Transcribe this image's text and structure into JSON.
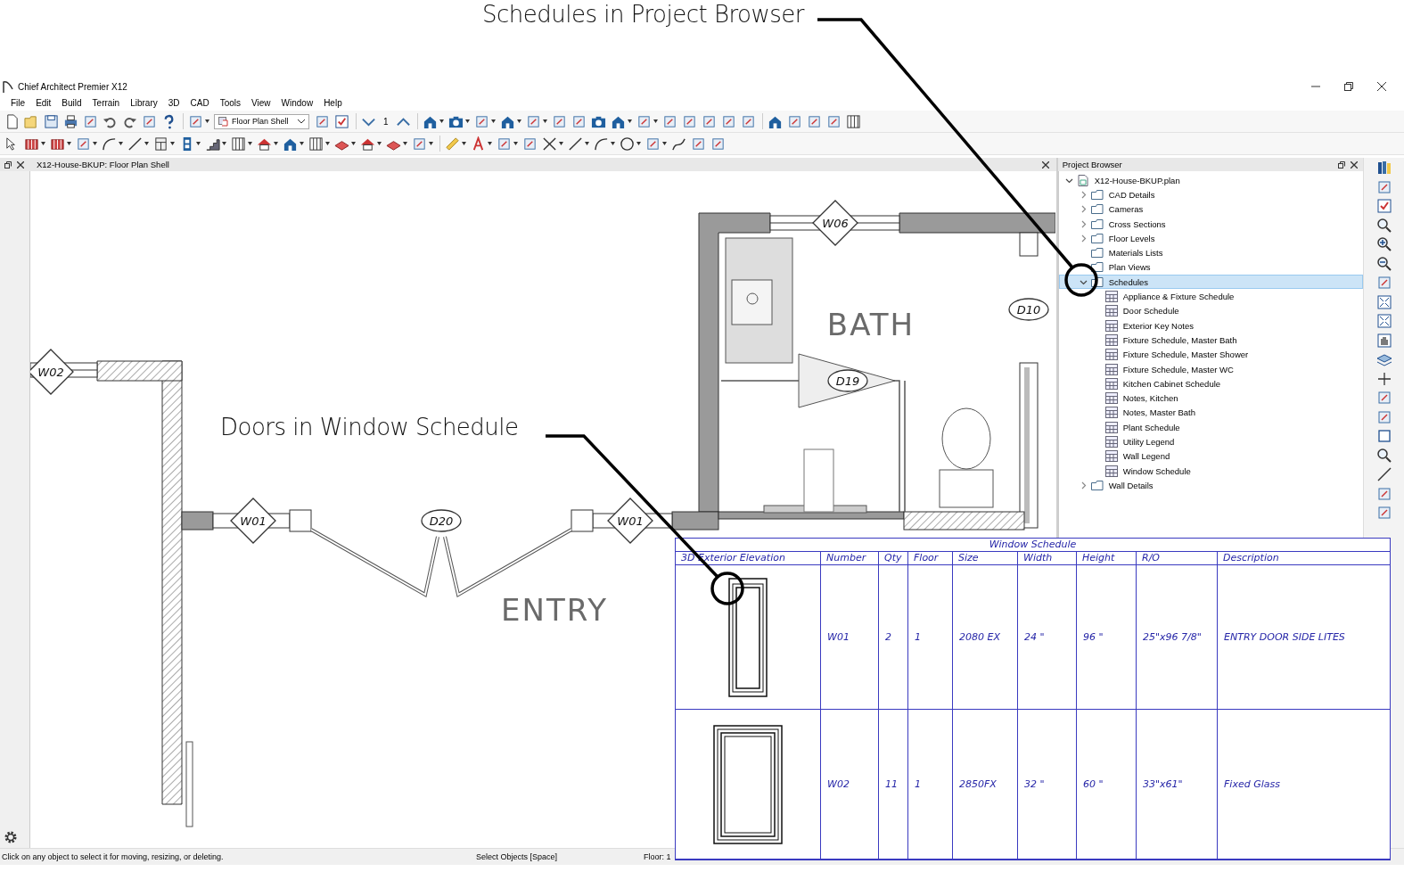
{
  "callouts": [
    {
      "text": "Schedules in Project Browser"
    },
    {
      "text": "Doors in Window Schedule"
    }
  ],
  "window": {
    "title": "Chief Architect Premier X12"
  },
  "menu": [
    "File",
    "Edit",
    "Build",
    "Terrain",
    "Library",
    "3D",
    "CAD",
    "Tools",
    "View",
    "Window",
    "Help"
  ],
  "toolbar": {
    "plan_dropdown": "Floor Plan Shell",
    "floor_number": "1"
  },
  "view": {
    "title": "X12-House-BKUP: Floor Plan Shell",
    "plan_labels": [
      {
        "kind": "window",
        "text": "W02"
      },
      {
        "kind": "window",
        "text": "W06"
      },
      {
        "kind": "door",
        "text": "D10"
      },
      {
        "kind": "door",
        "text": "D19"
      },
      {
        "kind": "window",
        "text": "W01"
      },
      {
        "kind": "door",
        "text": "D20"
      },
      {
        "kind": "window",
        "text": "W01"
      },
      {
        "kind": "room",
        "text": "BATH"
      },
      {
        "kind": "room",
        "text": "ENTRY"
      }
    ]
  },
  "project_browser": {
    "title": "Project Browser",
    "root": {
      "label": "X12-House-BKUP.plan",
      "kind": "plan",
      "expanded": true,
      "selected": false,
      "children": [
        {
          "label": "CAD Details",
          "kind": "folder",
          "expanded": false,
          "selected": false
        },
        {
          "label": "Cameras",
          "kind": "folder",
          "expanded": false,
          "selected": false
        },
        {
          "label": "Cross Sections",
          "kind": "folder",
          "expanded": false,
          "selected": false
        },
        {
          "label": "Floor Levels",
          "kind": "folder",
          "expanded": false,
          "selected": false
        },
        {
          "label": "Materials Lists",
          "kind": "folder",
          "selected": false
        },
        {
          "label": "Plan Views",
          "kind": "folder",
          "selected": false
        },
        {
          "label": "Schedules",
          "kind": "folder",
          "expanded": true,
          "selected": true,
          "children": [
            {
              "label": "Appliance & Fixture Schedule",
              "kind": "schedule",
              "selected": false
            },
            {
              "label": "Door Schedule",
              "kind": "schedule",
              "selected": false
            },
            {
              "label": "Exterior Key Notes",
              "kind": "schedule",
              "selected": false
            },
            {
              "label": "Fixture Schedule, Master Bath",
              "kind": "schedule",
              "selected": false
            },
            {
              "label": "Fixture Schedule, Master Shower",
              "kind": "schedule",
              "selected": false
            },
            {
              "label": "Fixture Schedule, Master WC",
              "kind": "schedule",
              "selected": false
            },
            {
              "label": "Kitchen Cabinet Schedule",
              "kind": "schedule",
              "selected": false
            },
            {
              "label": "Notes, Kitchen",
              "kind": "schedule",
              "selected": false
            },
            {
              "label": "Notes, Master Bath",
              "kind": "schedule",
              "selected": false
            },
            {
              "label": "Plant Schedule",
              "kind": "schedule",
              "selected": false
            },
            {
              "label": "Utility Legend",
              "kind": "schedule",
              "selected": false
            },
            {
              "label": "Wall Legend",
              "kind": "schedule",
              "selected": false
            },
            {
              "label": "Window Schedule",
              "kind": "schedule",
              "selected": false
            }
          ]
        },
        {
          "label": "Wall Details",
          "kind": "folder",
          "expanded": false,
          "selected": false
        }
      ]
    }
  },
  "schedule": {
    "title": "Window Schedule",
    "columns": [
      "3D Exterior Elevation",
      "Number",
      "Qty",
      "Floor",
      "Size",
      "Width",
      "Height",
      "R/O",
      "Description"
    ],
    "rows": [
      {
        "cells": [
          "",
          "W01",
          "2",
          "1",
          "2080 EX",
          "24 \"",
          "96 \"",
          "25\"x96 7/8\"",
          "ENTRY DOOR SIDE LITES"
        ]
      },
      {
        "cells": [
          "",
          "W02",
          "11",
          "1",
          "2850FX",
          "32 \"",
          "60 \"",
          "33\"x61\"",
          "Fixed Glass"
        ]
      }
    ]
  },
  "status_bar": {
    "hint": "Click on any object to select it for moving, resizing, or deleting.",
    "mode": "Select Objects [Space]",
    "floor": "Floor: 1"
  }
}
